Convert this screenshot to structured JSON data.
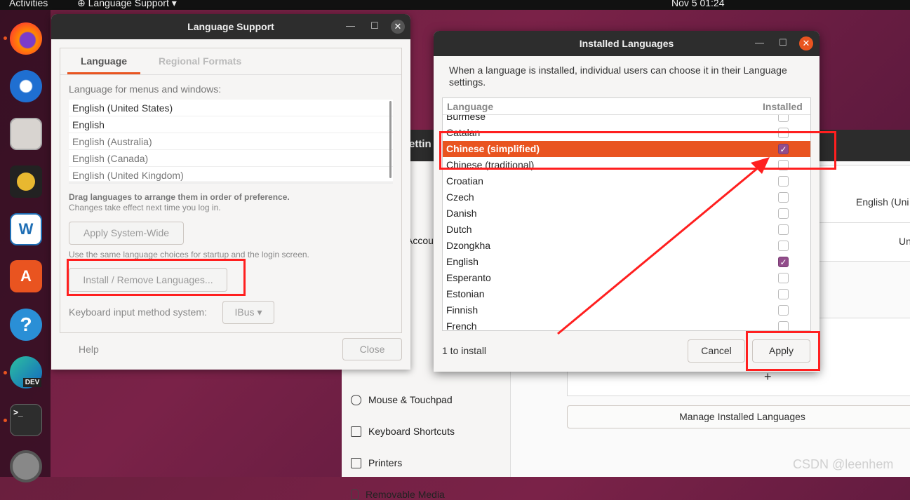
{
  "topbar": {
    "activities": "Activities",
    "app_menu": "Language Support",
    "clock": "Nov 5  01:24"
  },
  "dock": {
    "items": [
      "firefox-icon",
      "thunderbird-icon",
      "files-icon",
      "rhythmbox-icon",
      "libreoffice-writer-icon",
      "software-icon",
      "help-icon",
      "edge-dev-icon",
      "terminal-icon",
      "settings-icon"
    ],
    "edge_badge": "DEV",
    "terminal_glyph": ">_"
  },
  "settings_window": {
    "title_partial": "Settin",
    "sidebar": {
      "accounts_partial": "Accou",
      "mouse": "Mouse & Touchpad",
      "keyboard": "Keyboard Shortcuts",
      "printers": "Printers",
      "removable": "Removable Media"
    },
    "language_value": "English (Uni",
    "formats_value": "Un",
    "add_symbol": "+",
    "manage_button": "Manage Installed Languages"
  },
  "language_support": {
    "title": "Language Support",
    "tabs": [
      "Language",
      "Regional Formats"
    ],
    "list_label": "Language for menus and windows:",
    "languages": [
      "English (United States)",
      "English",
      "English (Australia)",
      "English (Canada)",
      "English (United Kingdom)"
    ],
    "drag_hint": "Drag languages to arrange them in order of preference.",
    "drag_sub": "Changes take effect next time you log in.",
    "apply_system_wide": "Apply System-Wide",
    "apply_hint": "Use the same language choices for startup and the login screen.",
    "install_remove": "Install / Remove Languages...",
    "input_label": "Keyboard input method system:",
    "input_value": "IBus",
    "help": "Help",
    "close": "Close"
  },
  "installed_languages": {
    "title": "Installed Languages",
    "description": "When a language is installed, individual users can choose it in their Language settings.",
    "col_language": "Language",
    "col_installed": "Installed",
    "rows": [
      {
        "name": "Burmese",
        "installed": false
      },
      {
        "name": "Catalan",
        "installed": false
      },
      {
        "name": "Chinese (simplified)",
        "installed": true,
        "selected": true
      },
      {
        "name": "Chinese (traditional)",
        "installed": false
      },
      {
        "name": "Croatian",
        "installed": false
      },
      {
        "name": "Czech",
        "installed": false
      },
      {
        "name": "Danish",
        "installed": false
      },
      {
        "name": "Dutch",
        "installed": false
      },
      {
        "name": "Dzongkha",
        "installed": false
      },
      {
        "name": "English",
        "installed": true
      },
      {
        "name": "Esperanto",
        "installed": false
      },
      {
        "name": "Estonian",
        "installed": false
      },
      {
        "name": "Finnish",
        "installed": false
      },
      {
        "name": "French",
        "installed": false
      }
    ],
    "status": "1 to install",
    "cancel": "Cancel",
    "apply": "Apply"
  },
  "watermark": "CSDN @leenhem",
  "colors": {
    "accent": "#e95420",
    "checkbox": "#924d8b",
    "annotation": "#ff1f1f"
  }
}
